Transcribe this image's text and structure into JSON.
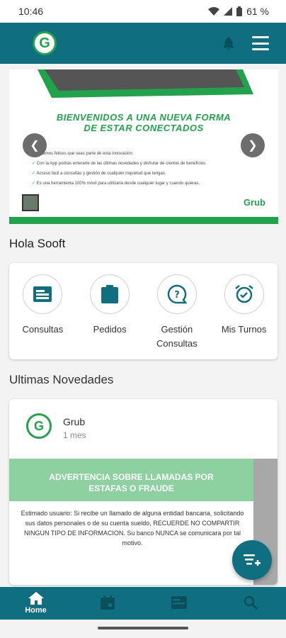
{
  "status_bar": {
    "time": "10:46",
    "battery": "61 %"
  },
  "header": {
    "logo_letter": "G"
  },
  "banner": {
    "title_line1": "BIENVENIDOS A UNA NUEVA FORMA",
    "title_line2": "DE ESTAR CONECTADOS",
    "items": [
      "Estamos felices que seas parte de esta innovación.",
      "Con la App podrás enterarte de las últimas novedades y disfrutar de cientos de beneficios.",
      "Acceso fácil a consultas y gestión de cualquier inquietud que tengas.",
      "Es una herramienta 100% móvil para utilizarla desde cualquier lugar y cuando quieras."
    ],
    "brand": "Grub"
  },
  "greeting": "Hola Sooft",
  "actions": [
    {
      "label": "Consultas"
    },
    {
      "label": "Pedidos"
    },
    {
      "label": "Gestión Consultas"
    },
    {
      "label": "Mis Turnos"
    }
  ],
  "news": {
    "section_title": "Ultimas Novedades",
    "author": "Grub",
    "time": "1 mes",
    "header_line1": "ADVERTENCIA SOBRE LLAMADAS POR",
    "header_line2": "ESTAFAS O FRAUDE",
    "body": "Estimado usuario: Si recibe un llamado de alguna entidad bancaria, solicitando sus datos personales o de su cuenta sueldo, RECUERDE NO COMPARTIR NINGUN TIPO DE INFORMACION. Su banco NUNCA se comunicara por tal motivo."
  },
  "bottom_nav": {
    "home_label": "Home"
  },
  "colors": {
    "primary": "#0f6e80",
    "accent": "#21a34b"
  }
}
